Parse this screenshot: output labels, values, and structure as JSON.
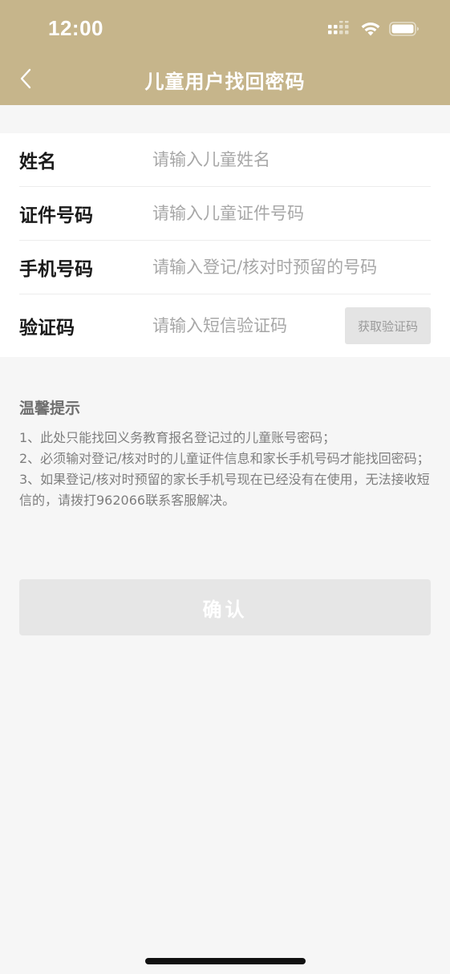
{
  "status_bar": {
    "time": "12:00"
  },
  "nav": {
    "back_icon": "chevron-left-icon",
    "title": "儿童用户找回密码"
  },
  "form": {
    "rows": [
      {
        "label": "姓名",
        "placeholder": "请输入儿童姓名",
        "value": ""
      },
      {
        "label": "证件号码",
        "placeholder": "请输入儿童证件号码",
        "value": ""
      },
      {
        "label": "手机号码",
        "placeholder": "请输入登记/核对时预留的号码",
        "value": ""
      },
      {
        "label": "验证码",
        "placeholder": "请输入短信验证码",
        "value": ""
      }
    ],
    "get_code_label": "获取验证码"
  },
  "tips": {
    "title": "温馨提示",
    "items": [
      "1、此处只能找回义务教育报名登记过的儿童账号密码；",
      "2、必须输对登记/核对时的儿童证件信息和家长手机号码才能找回密码；",
      "3、如果登记/核对时预留的家长手机号现在已经没有在使用，无法接收短信的，请拨打962066联系客服解决。"
    ]
  },
  "confirm_label": "确认",
  "colors": {
    "header_bg": "#c6b58b",
    "page_bg": "#f6f6f6",
    "button_disabled_bg": "#e6e6e6"
  }
}
